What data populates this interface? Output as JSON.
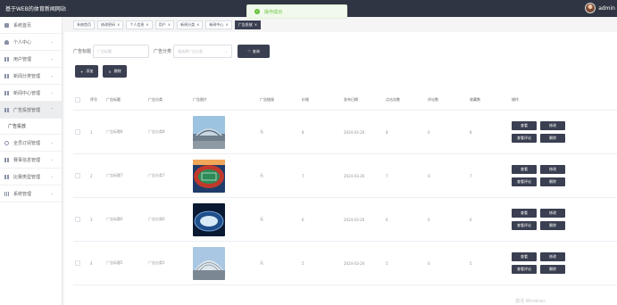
{
  "app": {
    "title": "基于WEB的体育新闻网站",
    "user_name": "admin"
  },
  "toast": {
    "text": "操作成功"
  },
  "sidebar": {
    "items": [
      {
        "label": "系统首页",
        "icon": "home-icon",
        "chevron": ""
      },
      {
        "label": "个人中心",
        "icon": "person-icon",
        "chevron": "⌄"
      },
      {
        "label": "用户管理",
        "icon": "grid-icon",
        "chevron": "⌄"
      },
      {
        "label": "新闻分类管理",
        "icon": "grid-icon",
        "chevron": "⌄"
      },
      {
        "label": "新闻中心管理",
        "icon": "grid-icon",
        "chevron": "⌄"
      },
      {
        "label": "广告投放管理",
        "icon": "grid-icon",
        "chevron": "⌃"
      },
      {
        "label": "广告投放",
        "icon": "",
        "chevron": ""
      },
      {
        "label": "全员订阅管理",
        "icon": "people-icon",
        "chevron": "⌄"
      },
      {
        "label": "赛事信息管理",
        "icon": "grid-icon",
        "chevron": "⌄"
      },
      {
        "label": "比赛类型管理",
        "icon": "grid-icon",
        "chevron": "⌄"
      },
      {
        "label": "系统管理",
        "icon": "bars-icon",
        "chevron": "⌄"
      }
    ]
  },
  "tabs": [
    {
      "label": "系统首页",
      "closable": false
    },
    {
      "label": "修改密码",
      "closable": true
    },
    {
      "label": "个人信息",
      "closable": true
    },
    {
      "label": "用户",
      "closable": true
    },
    {
      "label": "新闻分类",
      "closable": true
    },
    {
      "label": "新闻中心",
      "closable": true
    },
    {
      "label": "广告投放",
      "closable": true
    }
  ],
  "tab_close": "×",
  "search": {
    "title_label": "广告标题",
    "title_placeholder": "广告标题",
    "type_label": "广告分类",
    "type_placeholder": "请选择广告分类",
    "type_arrow": "⌄",
    "search_button": "查询",
    "search_icon": "♡"
  },
  "actions": {
    "add": "添加",
    "add_icon": "+",
    "delete": "删除",
    "delete_icon": "×"
  },
  "table": {
    "columns": [
      "序号",
      "广告标题",
      "广告分类",
      "广告图片",
      "广告链接",
      "价格",
      "发布日期",
      "点击次数",
      "评论数",
      "收藏数",
      "操作"
    ],
    "rows": [
      {
        "index": "1",
        "title": "广告标题8",
        "type": "广告分类8",
        "link": "无",
        "price": "8",
        "date": "2024-03-26",
        "clicks": "8",
        "comments": "0",
        "favorites": "8",
        "image": "stadium-exterior"
      },
      {
        "index": "2",
        "title": "广告标题7",
        "type": "广告分类7",
        "link": "无",
        "price": "7",
        "date": "2024-03-26",
        "clicks": "7",
        "comments": "0",
        "favorites": "7",
        "image": "stadium-aerial"
      },
      {
        "index": "3",
        "title": "广告标题6",
        "type": "广告分类6",
        "link": "无",
        "price": "6",
        "date": "2024-03-26",
        "clicks": "6",
        "comments": "0",
        "favorites": "6",
        "image": "stadium-night"
      },
      {
        "index": "4",
        "title": "广告标题5",
        "type": "广告分类5",
        "link": "无",
        "price": "5",
        "date": "2024-03-26",
        "clicks": "5",
        "comments": "0",
        "favorites": "5",
        "image": "stadium-dome"
      }
    ],
    "row_buttons": {
      "view": "查看",
      "edit": "修改",
      "view_comments": "查看评论",
      "delete": "删除"
    }
  },
  "watermark": "激活 Windows",
  "colors": {
    "sidebar_bg": "#ffffff",
    "topbar_bg": "#2f3542",
    "button_dark": "#3a3f51",
    "success": "#67c23a"
  }
}
